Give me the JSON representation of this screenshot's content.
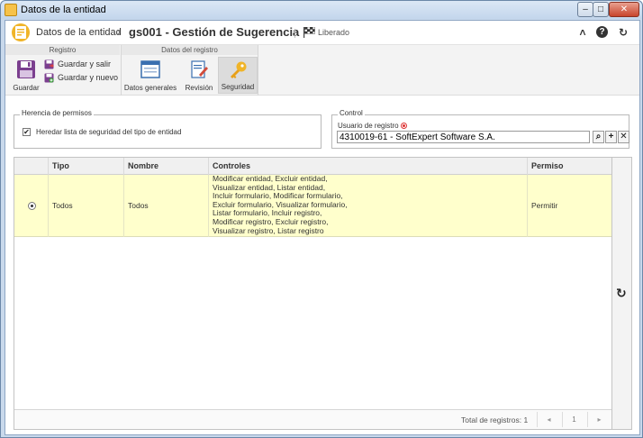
{
  "window": {
    "title": "Datos de la entidad",
    "controls": {
      "minimize": "–",
      "maximize": "□",
      "close": "✕"
    }
  },
  "header": {
    "breadcrumb": "Datos de la entidad",
    "separator": "›",
    "title": "gs001 - Gestión de Sugerencia",
    "status": "Liberado",
    "status_icon": "checkered-flag-icon",
    "icons": {
      "collapse": "˄",
      "help": "?",
      "refresh": "↻"
    }
  },
  "ribbon": {
    "groups": [
      {
        "label": "Registro"
      },
      {
        "label": "Datos del registro"
      }
    ],
    "save": "Guardar",
    "save_exit": "Guardar y salir",
    "save_new": "Guardar y nuevo",
    "general_data": "Datos generales",
    "revision": "Revisión",
    "security": "Seguridad"
  },
  "inheritance": {
    "legend": "Herencia de permisos",
    "checkbox_label": "Heredar lista de seguridad del tipo de entidad",
    "checked": true,
    "check_mark": "✔"
  },
  "control": {
    "legend": "Control",
    "field_label": "Usuario de registro",
    "value": "4310019-61 - SoftExpert Software S.A.",
    "buttons": {
      "search": "⌕",
      "add": "+",
      "clear": "✕"
    }
  },
  "grid": {
    "columns": [
      "",
      "Tipo",
      "Nombre",
      "Controles",
      "Permiso"
    ],
    "rows": [
      {
        "selected": true,
        "tipo": "Todos",
        "nombre": "Todos",
        "controles": [
          "Modificar entidad, Excluir entidad,",
          "Visualizar entidad, Listar entidad,",
          "Incluir formulario, Modificar formulario,",
          "Excluir formulario, Visualizar formulario,",
          "Listar formulario, Incluir registro,",
          "Modificar registro, Excluir registro,",
          "Visualizar registro, Listar registro"
        ],
        "permiso": "Permitir"
      }
    ],
    "footer": {
      "total": "Total de registros: 1",
      "prev": "◂",
      "page": "1",
      "next": "▸"
    },
    "side_refresh": "↻"
  }
}
